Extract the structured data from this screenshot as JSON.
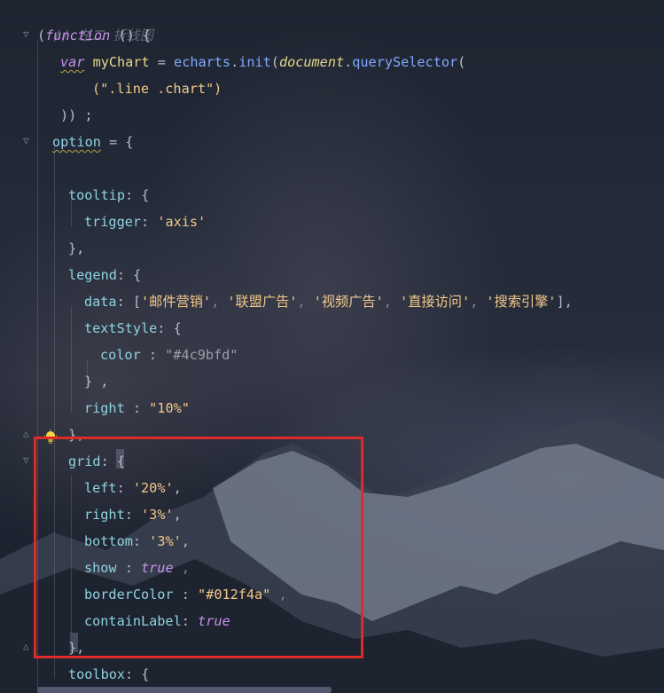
{
  "editor": {
    "lines": {
      "l0": {
        "comment": "// 左二 折线图"
      },
      "l1": {
        "open": "(",
        "function_kw": "function",
        "rest": " () {"
      },
      "l2": {
        "var_kw": "var",
        "space": " ",
        "var_name": "myChart",
        "eq": " = ",
        "obj": "echarts",
        "dot": ".",
        "method": "init",
        "paren": "(",
        "doc": "document",
        "dot2": ".",
        "method2": "querySelector",
        "paren2": "("
      },
      "l3": {
        "arg": "(\".line .chart\")"
      },
      "l4": {
        "close": ")) ;"
      },
      "l5": {
        "option": "option",
        "rest": " = {"
      },
      "l6": {
        "text": ""
      },
      "l7": {
        "key": "tooltip",
        "rest": ": {"
      },
      "l8": {
        "key": "trigger",
        "colon": ": ",
        "value": "'axis'"
      },
      "l9": {
        "text": "},"
      },
      "l10": {
        "key": "legend",
        "rest": ": {"
      },
      "l11": {
        "key": "data",
        "colon": ": [",
        "v1": "'邮件营销'",
        "c1": ", ",
        "v2": "'联盟广告'",
        "c2": ", ",
        "v3": "'视频广告'",
        "c3": ", ",
        "v4": "'直接访问'",
        "c4": ", ",
        "v5": "'搜索引擎'",
        "end": "],"
      },
      "l12": {
        "key": "textStyle",
        "rest": ": {"
      },
      "l13": {
        "key": "color",
        "colon": " : ",
        "value": "\"#4c9bfd\""
      },
      "l14": {
        "text": "} ,"
      },
      "l15": {
        "key": "right",
        "colon": " : ",
        "value": "\"10%\""
      },
      "l16": {
        "text": "},"
      },
      "l17": {
        "key": "grid",
        "rest": ": {"
      },
      "l18": {
        "key": "left",
        "colon": ": ",
        "value": "'20%'",
        "comma": ","
      },
      "l19": {
        "key": "right",
        "colon": ": ",
        "value": "'3%'",
        "comma": ","
      },
      "l20": {
        "key": "bottom",
        "colon": ": ",
        "value": "'3%'",
        "comma": ","
      },
      "l21": {
        "key": "show",
        "colon": " : ",
        "value": "true",
        "comma": " ,"
      },
      "l22": {
        "key": "borderColor",
        "colon": " : ",
        "value": "\"#012f4a\"",
        "comma": " ,"
      },
      "l23": {
        "key": "containLabel",
        "colon": ": ",
        "value": "true"
      },
      "l24": {
        "text": "},"
      },
      "l25": {
        "key": "toolbox",
        "rest": ": {"
      }
    }
  },
  "colors": {
    "highlight_border": "#e02a2a",
    "keyword": "#c792ea",
    "function": "#82aaff",
    "string": "#f2c98a",
    "property": "#8fd3e0"
  },
  "icons": {
    "bulb": "lightbulb-icon",
    "fold": "fold-marker-icon"
  }
}
